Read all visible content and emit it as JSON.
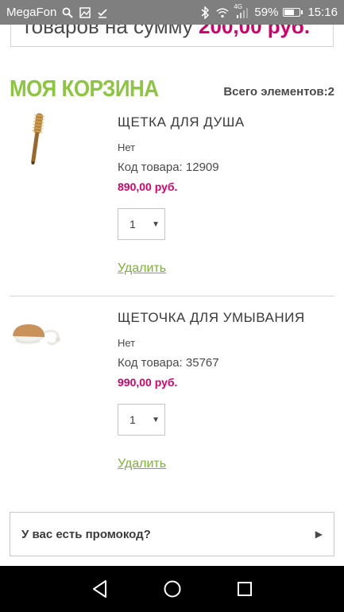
{
  "status_bar": {
    "carrier": "MegaFon",
    "network": "4G",
    "battery_percent": "59%",
    "battery_level": 0.59,
    "time": "15:16",
    "left_icons": [
      "search-icon",
      "image-icon",
      "check-icon"
    ],
    "right_icons": [
      "bluetooth-icon",
      "wifi-icon",
      "signal-icon",
      "battery-icon"
    ]
  },
  "banner": {
    "text": "товаров на сумму",
    "amount": "200,00 руб."
  },
  "cart": {
    "title": "МОЯ КОРЗИНА",
    "total_label": "Всего элементов:2"
  },
  "products": [
    {
      "name": "ЩЕТКА ДЛЯ ДУША",
      "availability": "Нет",
      "code_label": "Код товара:",
      "code": "12909",
      "price": "890,00 руб.",
      "quantity": "1",
      "remove_label": "Удалить",
      "image_icon": "bath-brush-icon"
    },
    {
      "name": "ЩЕТОЧКА ДЛЯ УМЫВАНИЯ",
      "availability": "Нет",
      "code_label": "Код товара:",
      "code": "35767",
      "price": "990,00 руб.",
      "quantity": "1",
      "remove_label": "Удалить",
      "image_icon": "face-brush-icon"
    }
  ],
  "promo": {
    "label": "У вас есть промокод?",
    "arrow_icon": "triangle-right-icon"
  },
  "nav_bar": {
    "icons": [
      "back-icon",
      "home-icon",
      "recents-icon"
    ]
  },
  "colors": {
    "accent_green": "#8cc63f",
    "link_green": "#7ab332",
    "price_magenta": "#d4006a",
    "status_bar_bg": "#7f7f7f",
    "nav_bar_bg": "#000000"
  }
}
